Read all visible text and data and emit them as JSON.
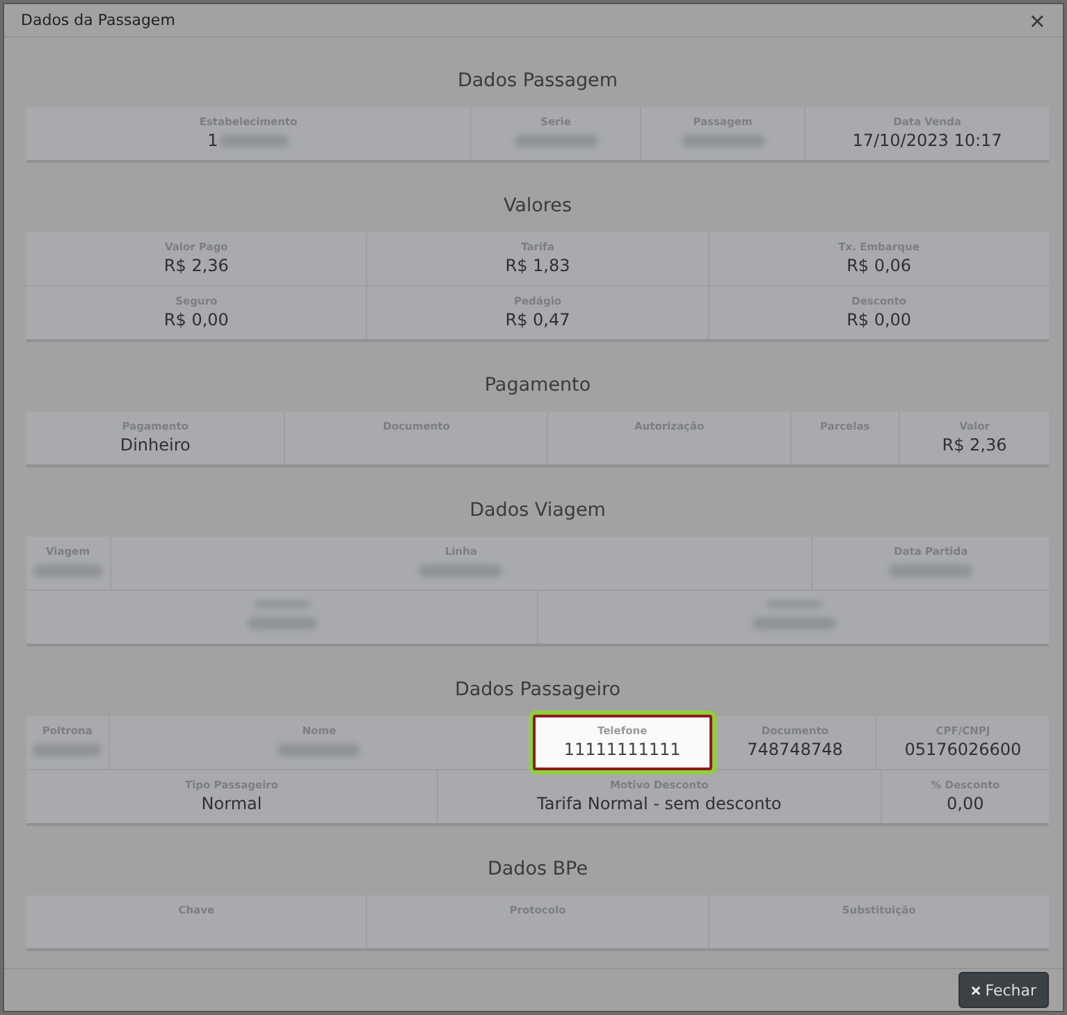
{
  "dialog": {
    "title": "Dados da Passagem",
    "close": "×"
  },
  "sections": [
    {
      "title": "Dados Passagem",
      "rows": [
        {
          "fields": [
            {
              "label": "Estabelecimento",
              "value": "1",
              "redacted": true
            },
            {
              "label": "Serie",
              "redacted": true
            },
            {
              "label": "Passagem",
              "redacted": true
            },
            {
              "label": "Data Venda",
              "value": "17/10/2023 10:17"
            }
          ]
        }
      ]
    },
    {
      "title": "Valores",
      "rows": [
        {
          "fields": [
            {
              "label": "Valor Pago",
              "value": "R$ 2,36"
            },
            {
              "label": "Tarifa",
              "value": "R$ 1,83"
            },
            {
              "label": "Tx. Embarque",
              "value": "R$ 0,06"
            }
          ]
        },
        {
          "fields": [
            {
              "label": "Seguro",
              "value": "R$ 0,00"
            },
            {
              "label": "Pedágio",
              "value": "R$ 0,47"
            },
            {
              "label": "Desconto",
              "value": "R$ 0,00"
            }
          ]
        }
      ]
    },
    {
      "title": "Pagamento",
      "rows": [
        {
          "fields": [
            {
              "label": "Pagamento",
              "value": "Dinheiro"
            },
            {
              "label": "Documento"
            },
            {
              "label": "Autorização"
            },
            {
              "label": "Parcelas"
            },
            {
              "label": "Valor",
              "value": "R$ 2,36"
            }
          ]
        }
      ]
    },
    {
      "title": "Dados Viagem",
      "rows": [
        {
          "fields": [
            {
              "label": "Viagem",
              "redacted": true
            },
            {
              "label": "Linha",
              "redacted": true
            },
            {
              "label": "Data Partida",
              "redacted": true
            }
          ]
        },
        {
          "fields": [
            {
              "redacted": true
            },
            {
              "redacted": true
            }
          ]
        }
      ]
    },
    {
      "title": "Dados Passageiro",
      "rows": [
        {
          "fields": [
            {
              "label": "Poltrona",
              "redacted": true
            },
            {
              "label": "Nome",
              "redacted": true
            },
            {
              "label": "Telefone",
              "value": "11111111111",
              "highlighted": true
            },
            {
              "label": "Documento",
              "value": "748748748"
            },
            {
              "label": "CPF/CNPJ",
              "value": "05176026600"
            }
          ]
        },
        {
          "fields": [
            {
              "label": "Tipo Passageiro",
              "value": "Normal"
            },
            {
              "label": "Motivo Desconto",
              "value": "Tarifa Normal - sem desconto"
            },
            {
              "label": "% Desconto",
              "value": "0,00"
            }
          ]
        }
      ]
    },
    {
      "title": "Dados BPe",
      "rows": [
        {
          "fields": [
            {
              "label": "Chave"
            },
            {
              "label": "Protocolo"
            },
            {
              "label": "Substituição"
            }
          ]
        }
      ]
    }
  ],
  "footer": {
    "button": "Fechar"
  }
}
